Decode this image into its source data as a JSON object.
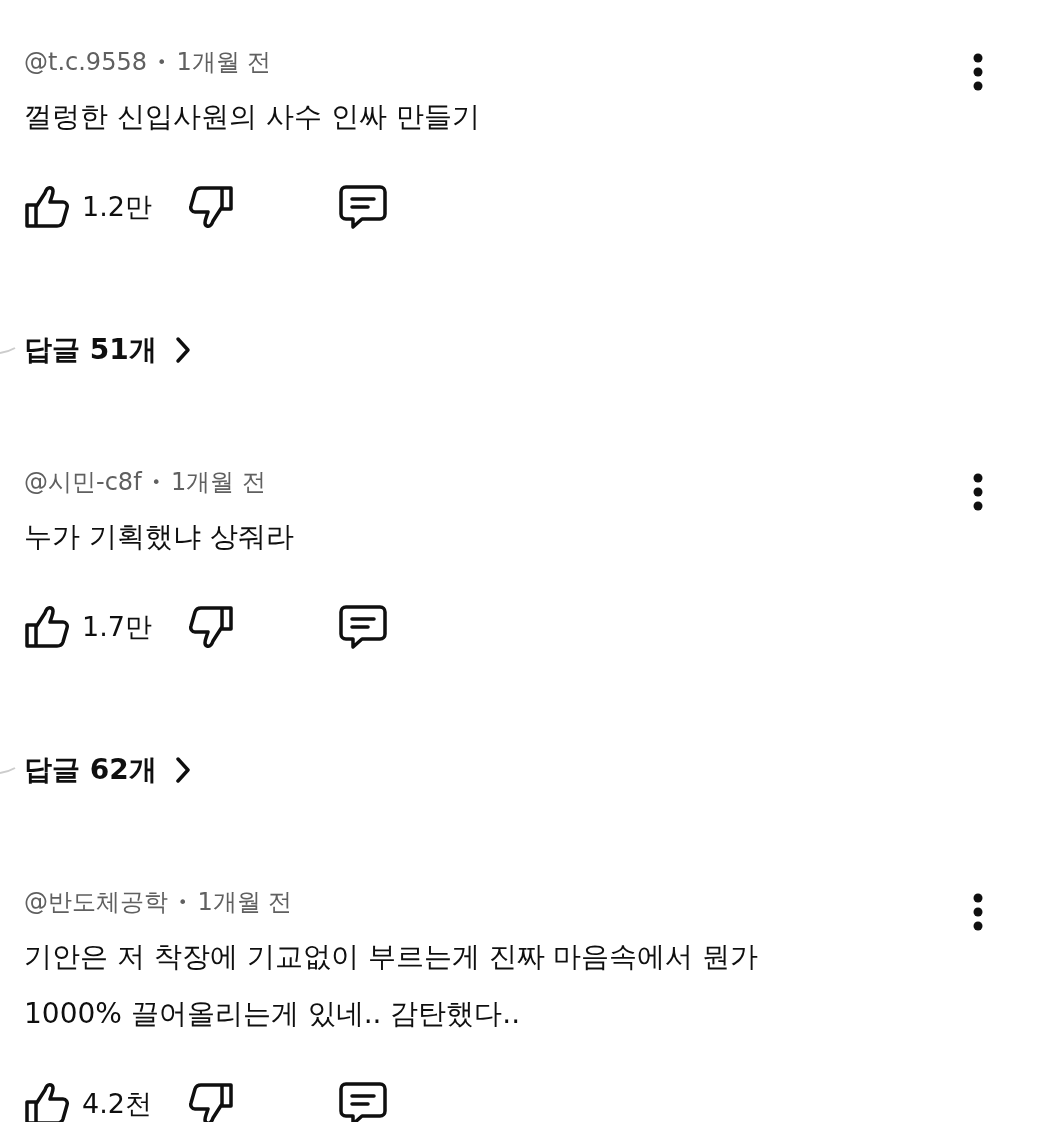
{
  "comments": [
    {
      "author": "@t.c.9558",
      "separator": "•",
      "time": "1개월 전",
      "text_lines": [
        "껄렁한 신입사원의 사수 인싸 만들기"
      ],
      "likes": "1.2만",
      "replies": "답글 51개"
    },
    {
      "author": "@시민-c8f",
      "separator": "•",
      "time": "1개월 전",
      "text_lines": [
        "누가 기획했냐 상줘라"
      ],
      "likes": "1.7만",
      "replies": "답글 62개"
    },
    {
      "author": "@반도체공학",
      "separator": "•",
      "time": "1개월 전",
      "text_lines": [
        "기안은 저 착장에 기교없이 부르는게 진짜 마음속에서 뭔가",
        "1000% 끌어올리는게 있네.. 감탄했다.."
      ],
      "likes": "4.2천"
    }
  ]
}
